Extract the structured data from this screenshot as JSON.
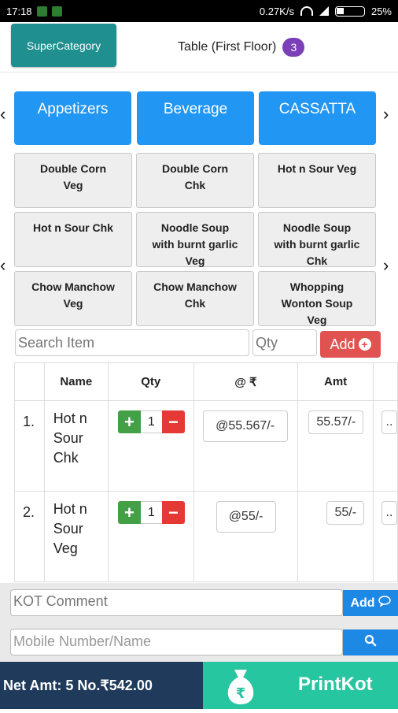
{
  "status": {
    "time": "17:18",
    "speed": "0.27K/s",
    "battery": "25%"
  },
  "header": {
    "supercategory_label": "SuperCategory",
    "table_label": "Table (First Floor)",
    "table_badge": "3"
  },
  "categories": [
    "Appetizers",
    "Beverage",
    "CASSATTA"
  ],
  "items": [
    [
      "Double Corn",
      "Veg"
    ],
    [
      "Double Corn",
      "Chk"
    ],
    [
      "Hot n Sour Veg"
    ],
    [
      "Hot n Sour Chk"
    ],
    [
      "Noodle Soup",
      "with burnt garlic",
      "Veg"
    ],
    [
      "Noodle Soup",
      "with burnt garlic",
      "Chk"
    ],
    [
      "Chow Manchow",
      "Veg"
    ],
    [
      "Chow Manchow",
      "Chk"
    ],
    [
      "Whopping",
      "Wonton Soup",
      "Veg"
    ]
  ],
  "search": {
    "item_placeholder": "Search Item",
    "qty_placeholder": "Qty",
    "add_label": "Add"
  },
  "table": {
    "headers": {
      "name": "Name",
      "qty": "Qty",
      "rate": "@ ₹",
      "amt": "Amt"
    },
    "rows": [
      {
        "num": "1.",
        "name": [
          "Hot n",
          "Sour",
          "Chk"
        ],
        "qty": "1",
        "rate": "@55.567/-",
        "amt": "55.57/-",
        "extra": ".."
      },
      {
        "num": "2.",
        "name": [
          "Hot n",
          "Sour",
          "Veg"
        ],
        "qty": "1",
        "rate": "@55/-",
        "amt": "55/-",
        "extra": ".."
      }
    ]
  },
  "kot": {
    "comment_placeholder": "KOT Comment",
    "add_label": "Add",
    "mobile_placeholder": "Mobile Number/Name"
  },
  "footer": {
    "net_amt": "Net Amt:  5 No.₹542.00",
    "print_label": "PrintKot"
  },
  "colors": {
    "accent": "#2196f3",
    "supercategory": "#1f8f8f",
    "add": "#e05350",
    "print": "#26c6a0",
    "net": "#1f3a5a"
  }
}
